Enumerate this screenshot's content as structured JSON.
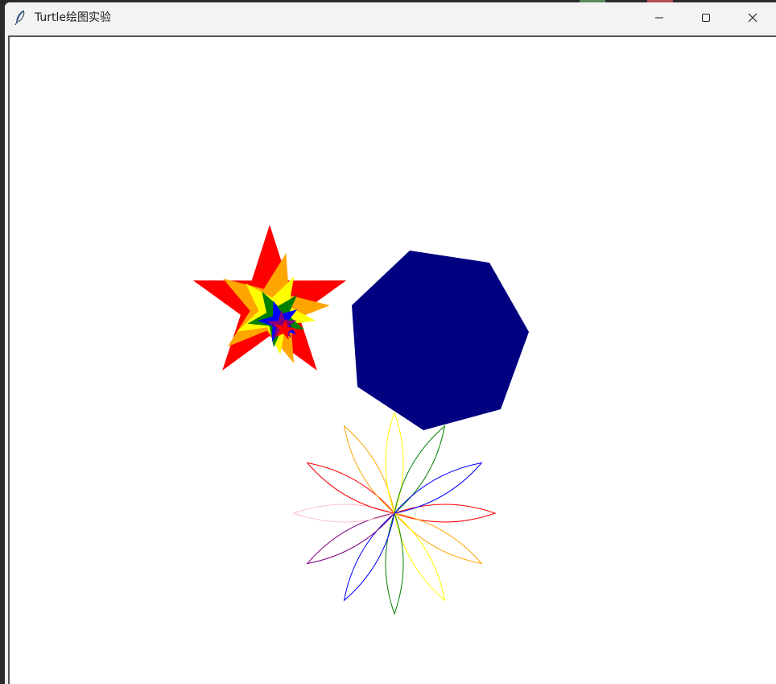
{
  "window": {
    "title": "Turtle绘图实验",
    "icon": "feather-icon",
    "controls": {
      "minimize": "minimize-icon",
      "maximize": "maximize-icon",
      "close": "close-icon"
    }
  },
  "canvas": {
    "background": "#ffffff",
    "drawings": {
      "star_spiral": {
        "colors": [
          "#ff0000",
          "#ffa500",
          "#ffff00",
          "#008000",
          "#0000ff",
          "#800080"
        ]
      },
      "hexagon": {
        "fill": "#000080"
      },
      "flower": {
        "petal_colors": [
          "#ff0000",
          "#ffa500",
          "#ffff00",
          "#008000",
          "#0000ff",
          "#800080",
          "#ffc0cb"
        ]
      }
    }
  }
}
